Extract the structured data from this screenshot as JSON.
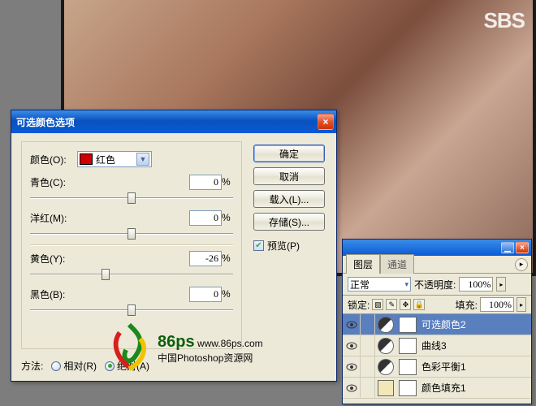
{
  "canvas": {
    "watermark": "SBS"
  },
  "dialog": {
    "title": "可选颜色选项",
    "close": "×",
    "color_label": "颜色(O):",
    "color_select": "红色",
    "sliders": [
      {
        "label": "青色(C):",
        "value": "0",
        "pos": 50
      },
      {
        "label": "洋红(M):",
        "value": "0",
        "pos": 50
      },
      {
        "label": "黄色(Y):",
        "value": "-26",
        "pos": 37
      },
      {
        "label": "黑色(B):",
        "value": "0",
        "pos": 50
      }
    ],
    "percent": "%",
    "method_label": "方法:",
    "methods": [
      {
        "label": "相对(R)",
        "checked": false
      },
      {
        "label": "绝对(A)",
        "checked": true
      }
    ],
    "buttons": {
      "ok": "确定",
      "cancel": "取消",
      "load": "载入(L)...",
      "save": "存储(S)..."
    },
    "preview_label": "预览(P)",
    "preview_checked": true
  },
  "palette": {
    "tabs": [
      "图层",
      "通道"
    ],
    "active_tab": 0,
    "blend_mode": "正常",
    "opacity_label": "不透明度:",
    "opacity": "100%",
    "lock_label": "锁定:",
    "fill_label": "填充:",
    "fill": "100%",
    "lock_icons": [
      "▧",
      "✎",
      "✥",
      "🔒"
    ],
    "layers": [
      {
        "name": "可选颜色2",
        "kind": "adj",
        "selected": true
      },
      {
        "name": "曲线3",
        "kind": "adj",
        "selected": false
      },
      {
        "name": "色彩平衡1",
        "kind": "adj",
        "selected": false
      },
      {
        "name": "颜色填充1",
        "kind": "solid",
        "selected": false
      }
    ]
  },
  "watermark": {
    "brand": "86ps",
    "url": "www.86ps.com",
    "sub": "中国Photoshop资源网"
  }
}
